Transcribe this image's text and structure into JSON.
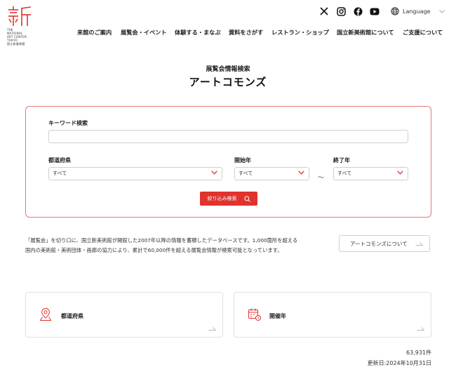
{
  "header": {
    "logo_lines": [
      "THE",
      "NATIONAL",
      "ART CENTER,",
      "TOKYO",
      "国立新美術館"
    ],
    "language_label": "Language",
    "social_icons": [
      "x-icon",
      "instagram-icon",
      "facebook-icon",
      "youtube-icon"
    ],
    "nav": [
      "来館のご案内",
      "展覧会・イベント",
      "体験する・まなぶ",
      "資料をさがす",
      "レストラン・ショップ",
      "国立新美術館について",
      "ご支援について"
    ]
  },
  "page": {
    "subtitle": "展覧会情報検索",
    "title": "アートコモンズ"
  },
  "search": {
    "keyword_label": "キーワード検索",
    "keyword_value": "",
    "prefecture_label": "都道府県",
    "prefecture_value": "すべて",
    "start_year_label": "開始年",
    "start_year_value": "すべて",
    "end_year_label": "終了年",
    "end_year_value": "すべて",
    "range_separator": "～",
    "submit_label": "絞り込み検索"
  },
  "description": {
    "line1": "「展覧会」を切り口に、国立新美術館が開館した2007年以降の情報を蓄積したデータベースです。1,000箇所を超える",
    "line2": "国内の美術館・美術団体・画廊の協力により、累計で60,000件を超える展覧会情報が検索可能となっています。",
    "about_button": "アートコモンズについて"
  },
  "cards": [
    {
      "label": "都道府県",
      "icon": "map-pin-icon"
    },
    {
      "label": "開催年",
      "icon": "calendar-icon"
    }
  ],
  "footer": {
    "count": "63,931件",
    "updated": "更新日:2024年10月31日"
  },
  "colors": {
    "accent": "#e0332d",
    "border_accent": "#e07a7a"
  }
}
